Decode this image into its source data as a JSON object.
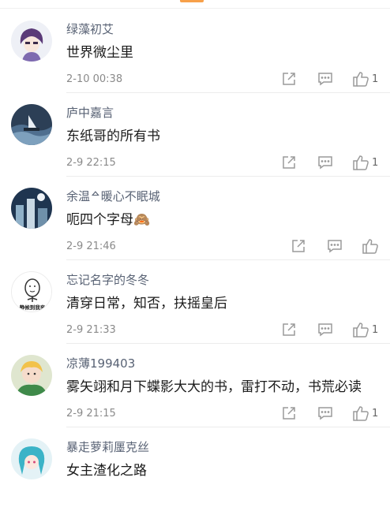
{
  "comments": [
    {
      "user": "绿藻初艾",
      "text": "世界微尘里",
      "time": "2-10 00:38",
      "likes": "1"
    },
    {
      "user": "庐中嘉言",
      "text": "东纸哥的所有书",
      "time": "2-9 22:15",
      "likes": "1"
    },
    {
      "user": "余温ᅀ暖心不眠城",
      "text": "呃四个字母🙈",
      "time": "2-9 21:46",
      "likes": ""
    },
    {
      "user": "忘记名字的冬冬",
      "text": "清穿日常，知否，扶摇皇后",
      "time": "2-9 21:33",
      "likes": "1",
      "avatar_caption": "静候到我来"
    },
    {
      "user": "凉薄199403",
      "text": "雾矢翊和月下蝶影大大的书，雷打不动，书荒必读",
      "time": "2-9 21:15",
      "likes": "1"
    },
    {
      "user": "暴走萝莉㕓克丝",
      "text": "女主渣化之路",
      "time": "",
      "likes": ""
    }
  ],
  "icons": {
    "share": "share-icon",
    "reply": "comment-icon",
    "like": "thumbs-up-icon"
  },
  "colors": {
    "username": "#586274",
    "accent": "#f7a04a",
    "time": "#8a8a8a"
  }
}
